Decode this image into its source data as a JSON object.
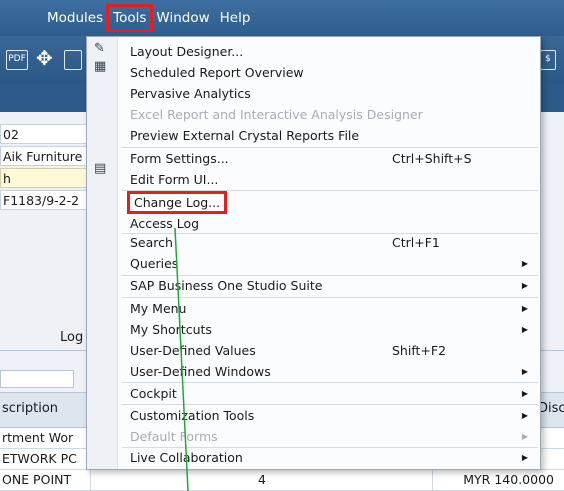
{
  "menubar": {
    "items": [
      {
        "label": "Modules"
      },
      {
        "label": "Tools"
      },
      {
        "label": "Window"
      },
      {
        "label": "Help"
      }
    ]
  },
  "toolbar": {
    "pdf_label": "PDF"
  },
  "form": {
    "fields": [
      "02",
      "Aik Furniture",
      "h",
      "F1183/9-2-2"
    ],
    "log_label": "Log"
  },
  "grid": {
    "header_description": "scription",
    "header_disc": "Disc",
    "rows": [
      {
        "desc": "rtment Wor",
        "qty": "",
        "price": ""
      },
      {
        "desc": "ETWORK PC",
        "qty": "",
        "price": ""
      },
      {
        "desc": "ONE POINT",
        "qty": "4",
        "price": "MYR 140.0000"
      }
    ]
  },
  "tools_menu": {
    "items": [
      {
        "label": "Layout Designer...",
        "shortcut": "",
        "submenu": false,
        "disabled": false
      },
      {
        "label": "Scheduled Report Overview",
        "shortcut": "",
        "submenu": false,
        "disabled": false
      },
      {
        "label": "Pervasive Analytics",
        "shortcut": "",
        "submenu": false,
        "disabled": false
      },
      {
        "label": "Excel Report and Interactive Analysis Designer",
        "shortcut": "",
        "submenu": false,
        "disabled": true
      },
      {
        "label": "Preview External Crystal Reports File",
        "shortcut": "",
        "submenu": false,
        "disabled": false
      },
      {
        "label": "Form Settings...",
        "shortcut": "Ctrl+Shift+S",
        "submenu": false,
        "disabled": false
      },
      {
        "label": "Edit Form UI...",
        "shortcut": "",
        "submenu": false,
        "disabled": false
      },
      {
        "label": "Change Log...",
        "shortcut": "",
        "submenu": false,
        "disabled": false
      },
      {
        "label": "Access Log",
        "shortcut": "",
        "submenu": false,
        "disabled": false
      },
      {
        "label": "Search",
        "shortcut": "Ctrl+F1",
        "submenu": false,
        "disabled": false
      },
      {
        "label": "Queries",
        "shortcut": "",
        "submenu": true,
        "disabled": false
      },
      {
        "label": "SAP Business One Studio Suite",
        "shortcut": "",
        "submenu": true,
        "disabled": false
      },
      {
        "label": "My Menu",
        "shortcut": "",
        "submenu": true,
        "disabled": false
      },
      {
        "label": "My Shortcuts",
        "shortcut": "",
        "submenu": true,
        "disabled": false
      },
      {
        "label": "User-Defined Values",
        "shortcut": "Shift+F2",
        "submenu": false,
        "disabled": false
      },
      {
        "label": "User-Defined Windows",
        "shortcut": "",
        "submenu": true,
        "disabled": false
      },
      {
        "label": "Cockpit",
        "shortcut": "",
        "submenu": true,
        "disabled": false
      },
      {
        "label": "Customization Tools",
        "shortcut": "",
        "submenu": true,
        "disabled": false
      },
      {
        "label": "Default Forms",
        "shortcut": "",
        "submenu": true,
        "disabled": true
      },
      {
        "label": "Live Collaboration",
        "shortcut": "",
        "submenu": true,
        "disabled": false
      }
    ]
  },
  "colors": {
    "menubar": "#2e5d8e",
    "highlight": "#e32020",
    "annotation_line": "#1fa83a"
  }
}
